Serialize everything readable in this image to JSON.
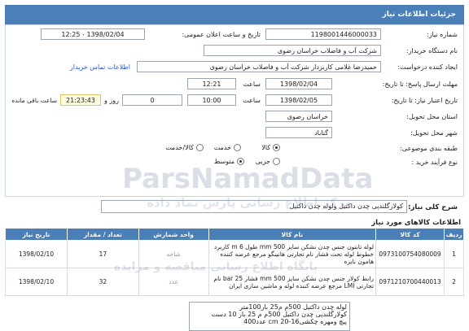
{
  "header": {
    "title": "جزئیات اطلاعات نیاز"
  },
  "form": {
    "need_number_label": "شماره نیاز:",
    "need_number": "1198001446000033",
    "announce_label": "تاریخ و ساعت اعلان عمومی:",
    "announce_value": "1398/02/04 - 12:25",
    "buyer_org_label": "نام دستگاه خریدار:",
    "buyer_org": "شرکت آب و فاضلاب خراسان رضوی",
    "creator_label": "ایجاد کننده درخواست:",
    "creator": "حمیدرضا غلامی کاربردار شرکت آب و فاضلاب خراسان رضوی",
    "contact_link": "اطلاعات تماس خریدار",
    "reply_deadline_label": "مهلت ارسال پاسخ: تا تاریخ:",
    "reply_date": "1398/02/04",
    "time_label": "ساعت",
    "reply_time": "12:21",
    "validity_label": "تاریخ اعتبار نیاز: تا تاریخ:",
    "validity_date": "1398/02/05",
    "validity_time": "10:00",
    "days_value": "0",
    "days_label": "روز و",
    "remaining_time": "21:23:43",
    "remaining_label": "ساعت باقی مانده",
    "province_label": "استان محل تحویل:",
    "province": "خراسان رضوی",
    "city_label": "شهر محل تحویل:",
    "city": "گناباد",
    "category_label": "طبقه بندی موضوعی:",
    "category_options": [
      "کالا",
      "خدمت",
      "کالا/خدمت"
    ],
    "category_selected": "کالا",
    "process_label": "نوع فرآیند خرید :",
    "process_options": [
      "جزیی",
      "متوسط"
    ],
    "process_selected": "متوسط"
  },
  "summary": {
    "label": "شرح کلی نیاز:",
    "value": "کولارگلندپی چدن داکتیل ولوله چدن داکتیل"
  },
  "items_section_title": "اطلاعات کالاهای مورد نیاز",
  "table": {
    "headers": [
      "ردیف",
      "کد کالا",
      "نام کالا",
      "واحد شمارش",
      "تعداد / مقدار",
      "تاریخ نیاز"
    ],
    "rows": [
      {
        "index": "1",
        "code": "0973100754080009",
        "name": "لوله تابتون جنس چدن نشکن سایز 500 mm طول m 6 کاربرد خطوط لوله تحت فشار نام تجارتی هانینگو مرجع عرضه کننده هامون نایزه",
        "unit": "شاخه",
        "qty": "17",
        "date": "1398/02/10"
      },
      {
        "index": "2",
        "code": "0971210700440013",
        "name": "رابط کولار جنس چدن نشکن سایز 500 mm فشار bar 25 نام تجارتی LMI مرجع عرضه کننده لوله و ماشین سازی ایران",
        "unit": "عدد",
        "qty": "32",
        "date": "1398/02/10"
      }
    ]
  },
  "notes": {
    "lines": [
      "لوله چدن داکتیل 500م م25 بار100متر",
      "کولارگلندپی چدن داکتیل 500م م 25 بار 10 دست",
      "پیچ ومهره چکشی16-20 cm عدد400"
    ]
  },
  "watermark": {
    "main": "ParsNamadData",
    "sub": "مرکز اطلاع رسانی پارس نماد داده",
    "sub2": "پایگاه اطلاع رسانی مناقصه و مزایده"
  }
}
